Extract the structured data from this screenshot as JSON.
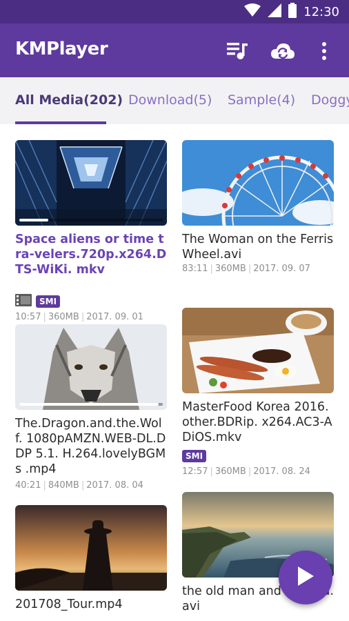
{
  "status_bar": {
    "time": "12:30"
  },
  "app_bar": {
    "title": "KMPlayer"
  },
  "tabs": [
    {
      "label": "All Media(202)"
    },
    {
      "label": "Download(5)"
    },
    {
      "label": "Sample(4)"
    },
    {
      "label": "Doggy"
    }
  ],
  "media": [
    {
      "title": "Space aliens or time tra-velers.720p.x264.DTS-WiKi. mkv",
      "duration": "10:57",
      "size": "360MB",
      "date": "2017. 09. 01",
      "badge": "SMI",
      "playing": true,
      "progress": 0.2
    },
    {
      "title": "The Woman on the Ferris Wheel.avi",
      "duration": "83:11",
      "size": "360MB",
      "date": "2017. 09. 07"
    },
    {
      "title": "The.Dragon.and.the.Wolf. 1080pAMZN.WEB-DL.DDP 5.1. H.264.lovelyBGMs .mp4",
      "duration": "40:21",
      "size": "840MB",
      "date": "2017. 08. 04",
      "progress": 0.97
    },
    {
      "title": "MasterFood Korea 2016. other.BDRip. x264.AC3-ADiOS.mkv",
      "duration": "12:57",
      "size": "360MB",
      "date": "2017. 08. 24",
      "badge": "SMI"
    },
    {
      "title": "201708_Tour.mp4"
    },
    {
      "title": "the old man and the sea.avi"
    }
  ],
  "colors": {
    "status_bar": "#4c2d84",
    "app_bar": "#5e3a9e",
    "accent": "#6b43b5",
    "tab_bg": "#f2f2f4"
  },
  "icons": {
    "playlist": "playlist-icon",
    "cloud_sync": "cloud-sync-icon",
    "more": "more-vert-icon",
    "play": "play-icon"
  }
}
